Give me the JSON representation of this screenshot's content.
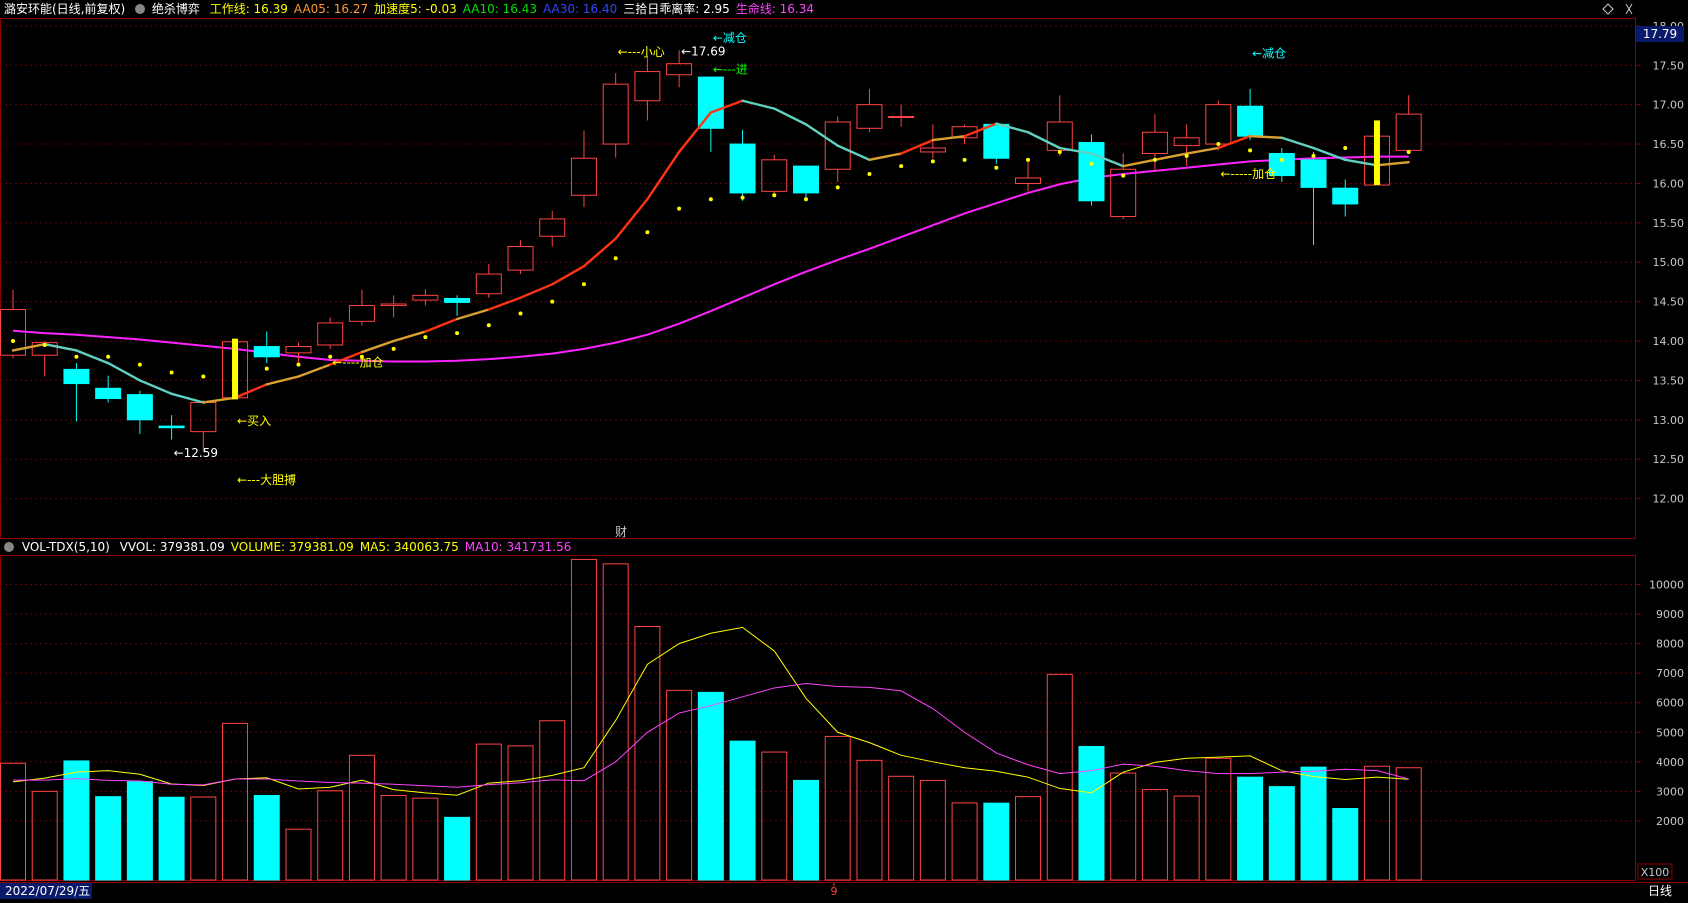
{
  "header": {
    "title": "潞安环能(日线,前复权)",
    "indicator": "绝杀博弈",
    "items": [
      {
        "label": "工作线:",
        "value": "16.39",
        "color": "#ffff00"
      },
      {
        "label": "AA05:",
        "value": "16.27",
        "color": "#ff9933"
      },
      {
        "label": "加速度5:",
        "value": "-0.03",
        "color": "#ffff00"
      },
      {
        "label": "AA10:",
        "value": "16.43",
        "color": "#00e000"
      },
      {
        "label": "AA30:",
        "value": "16.40",
        "color": "#3344ff"
      },
      {
        "label": "三拾日乖离率:",
        "value": "2.95",
        "color": "#ffffff"
      },
      {
        "label": "生命线:",
        "value": "16.34",
        "color": "#ff44ff"
      }
    ]
  },
  "vol_header": {
    "title": "VOL-TDX(5,10)",
    "items": [
      {
        "label": "VVOL:",
        "value": "379381.09",
        "color": "#ffffff"
      },
      {
        "label": "VOLUME:",
        "value": "379381.09",
        "color": "#ffff00"
      },
      {
        "label": "MA5:",
        "value": "340063.75",
        "color": "#ffff00"
      },
      {
        "label": "MA10:",
        "value": "341731.56",
        "color": "#ff44ff"
      }
    ]
  },
  "price_badge": "17.79",
  "footer": {
    "date": "2022/07/29/五",
    "month_marker": "9",
    "period": "日线"
  },
  "vol_unit": "X100",
  "finance_marker": "财",
  "colors": {
    "up": "#ff4444",
    "down": "#00ffff",
    "life": "#ff22ff",
    "dots": "#ffff00",
    "grid": "#660000",
    "text": "#c8c8c8"
  },
  "chart_data": {
    "type": "candlestick",
    "price_axis": {
      "ticks": [
        12.0,
        12.5,
        13.0,
        13.5,
        14.0,
        14.5,
        15.0,
        15.5,
        16.0,
        16.5,
        17.0,
        17.5,
        18.0
      ],
      "tick_labels": [
        "12.00",
        "12.50",
        "13.00",
        "13.50",
        "14.00",
        "14.50",
        "15.00",
        "15.50",
        "16.00",
        "16.50",
        "17.00",
        "17.50",
        "18.00"
      ],
      "range": [
        11.5,
        18.1
      ]
    },
    "volume_axis": {
      "ticks": [
        2000,
        3000,
        4000,
        5000,
        6000,
        7000,
        8000,
        9000,
        10000
      ],
      "tick_labels": [
        "2000",
        "3000",
        "4000",
        "5000",
        "6000",
        "7000",
        "8000",
        "9000",
        "10000"
      ],
      "range": [
        0,
        11000
      ]
    },
    "candles": [
      {
        "o": 13.82,
        "h": 14.65,
        "l": 13.78,
        "c": 14.4,
        "v": 3950
      },
      {
        "o": 13.82,
        "h": 14.0,
        "l": 13.55,
        "c": 13.98,
        "v": 3000
      },
      {
        "o": 13.64,
        "h": 13.72,
        "l": 12.98,
        "c": 13.46,
        "v": 4030
      },
      {
        "o": 13.4,
        "h": 13.56,
        "l": 13.22,
        "c": 13.27,
        "v": 2820
      },
      {
        "o": 13.32,
        "h": 13.37,
        "l": 12.82,
        "c": 13.0,
        "v": 3330
      },
      {
        "o": 12.92,
        "h": 13.06,
        "l": 12.75,
        "c": 12.9,
        "v": 2800
      },
      {
        "o": 12.85,
        "h": 13.25,
        "l": 12.59,
        "c": 13.22,
        "v": 2810
      },
      {
        "o": 13.28,
        "h": 14.03,
        "l": 13.26,
        "c": 13.99,
        "v": 5300
      },
      {
        "o": 13.93,
        "h": 14.12,
        "l": 13.72,
        "c": 13.8,
        "v": 2860
      },
      {
        "o": 13.85,
        "h": 13.98,
        "l": 13.72,
        "c": 13.93,
        "v": 1720
      },
      {
        "o": 13.95,
        "h": 14.3,
        "l": 13.9,
        "c": 14.23,
        "v": 3020
      },
      {
        "o": 14.25,
        "h": 14.65,
        "l": 14.2,
        "c": 14.45,
        "v": 4220
      },
      {
        "o": 14.45,
        "h": 14.58,
        "l": 14.3,
        "c": 14.47,
        "v": 2860
      },
      {
        "o": 14.52,
        "h": 14.66,
        "l": 14.45,
        "c": 14.58,
        "v": 2770
      },
      {
        "o": 14.54,
        "h": 14.58,
        "l": 14.32,
        "c": 14.49,
        "v": 2120
      },
      {
        "o": 14.6,
        "h": 14.98,
        "l": 14.55,
        "c": 14.85,
        "v": 4600
      },
      {
        "o": 14.9,
        "h": 15.28,
        "l": 14.85,
        "c": 15.2,
        "v": 4540
      },
      {
        "o": 15.33,
        "h": 15.65,
        "l": 15.2,
        "c": 15.55,
        "v": 5390
      },
      {
        "o": 15.85,
        "h": 16.67,
        "l": 15.7,
        "c": 16.32,
        "v": 10850
      },
      {
        "o": 16.5,
        "h": 17.4,
        "l": 16.33,
        "c": 17.26,
        "v": 10700
      },
      {
        "o": 17.05,
        "h": 17.62,
        "l": 16.8,
        "c": 17.42,
        "v": 8580
      },
      {
        "o": 17.38,
        "h": 17.69,
        "l": 17.22,
        "c": 17.52,
        "v": 6420
      },
      {
        "o": 17.35,
        "h": 17.35,
        "l": 16.4,
        "c": 16.7,
        "v": 6350
      },
      {
        "o": 16.5,
        "h": 16.68,
        "l": 15.78,
        "c": 15.88,
        "v": 4700
      },
      {
        "o": 15.9,
        "h": 16.36,
        "l": 15.84,
        "c": 16.3,
        "v": 4330
      },
      {
        "o": 16.22,
        "h": 16.22,
        "l": 15.8,
        "c": 15.88,
        "v": 3370
      },
      {
        "o": 16.18,
        "h": 16.85,
        "l": 16.02,
        "c": 16.78,
        "v": 4860
      },
      {
        "o": 16.7,
        "h": 17.2,
        "l": 16.65,
        "c": 17.0,
        "v": 4050
      },
      {
        "o": 16.85,
        "h": 17.0,
        "l": 16.72,
        "c": 16.85,
        "v": 3510
      },
      {
        "o": 16.4,
        "h": 16.75,
        "l": 16.32,
        "c": 16.45,
        "v": 3370
      },
      {
        "o": 16.58,
        "h": 16.75,
        "l": 16.5,
        "c": 16.72,
        "v": 2610
      },
      {
        "o": 16.75,
        "h": 16.76,
        "l": 16.25,
        "c": 16.32,
        "v": 2600
      },
      {
        "o": 16.0,
        "h": 16.28,
        "l": 15.9,
        "c": 16.07,
        "v": 2820
      },
      {
        "o": 16.42,
        "h": 17.12,
        "l": 16.35,
        "c": 16.78,
        "v": 6960
      },
      {
        "o": 16.52,
        "h": 16.62,
        "l": 15.72,
        "c": 15.78,
        "v": 4520
      },
      {
        "o": 15.58,
        "h": 16.38,
        "l": 15.55,
        "c": 16.18,
        "v": 3620
      },
      {
        "o": 16.38,
        "h": 16.88,
        "l": 16.15,
        "c": 16.65,
        "v": 3060
      },
      {
        "o": 16.48,
        "h": 16.75,
        "l": 16.22,
        "c": 16.58,
        "v": 2840
      },
      {
        "o": 16.5,
        "h": 17.05,
        "l": 16.42,
        "c": 17.0,
        "v": 4120
      },
      {
        "o": 16.98,
        "h": 17.2,
        "l": 16.55,
        "c": 16.6,
        "v": 3480
      },
      {
        "o": 16.38,
        "h": 16.45,
        "l": 16.02,
        "c": 16.1,
        "v": 3160
      },
      {
        "o": 16.3,
        "h": 16.4,
        "l": 15.22,
        "c": 15.95,
        "v": 3820
      },
      {
        "o": 15.94,
        "h": 16.05,
        "l": 15.58,
        "c": 15.74,
        "v": 2420
      },
      {
        "o": 15.98,
        "h": 16.8,
        "l": 15.98,
        "c": 16.6,
        "v": 3850
      },
      {
        "o": 16.42,
        "h": 17.12,
        "l": 16.4,
        "c": 16.88,
        "v": 3800
      }
    ],
    "work_line": [
      13.88,
      13.96,
      13.88,
      13.72,
      13.5,
      13.33,
      13.22,
      13.28,
      13.45,
      13.55,
      13.7,
      13.86,
      14.0,
      14.12,
      14.28,
      14.4,
      14.55,
      14.72,
      14.95,
      15.3,
      15.8,
      16.4,
      16.9,
      17.05,
      16.95,
      16.75,
      16.48,
      16.3,
      16.38,
      16.55,
      16.6,
      16.76,
      16.65,
      16.45,
      16.38,
      16.22,
      16.3,
      16.38,
      16.45,
      16.6,
      16.58,
      16.45,
      16.3,
      16.23,
      16.27
    ],
    "life_line": [
      14.13,
      14.1,
      14.08,
      14.05,
      14.02,
      13.98,
      13.94,
      13.9,
      13.85,
      13.8,
      13.76,
      13.75,
      13.74,
      13.74,
      13.75,
      13.77,
      13.8,
      13.84,
      13.9,
      13.98,
      14.08,
      14.22,
      14.38,
      14.55,
      14.72,
      14.88,
      15.03,
      15.17,
      15.32,
      15.47,
      15.62,
      15.75,
      15.88,
      15.99,
      16.07,
      16.12,
      16.16,
      16.2,
      16.24,
      16.28,
      16.3,
      16.32,
      16.33,
      16.34,
      16.34
    ],
    "dots": [
      14.0,
      13.95,
      13.8,
      13.8,
      13.7,
      13.6,
      13.55,
      13.5,
      13.65,
      13.7,
      13.8,
      13.8,
      13.9,
      14.05,
      14.1,
      14.2,
      14.35,
      14.5,
      14.72,
      15.05,
      15.38,
      15.68,
      15.8,
      15.82,
      15.85,
      15.8,
      15.95,
      16.12,
      16.22,
      16.28,
      16.3,
      16.2,
      16.3,
      16.4,
      16.25,
      16.1,
      16.3,
      16.35,
      16.5,
      16.42,
      16.3,
      16.35,
      16.45,
      16.3,
      16.4
    ],
    "vol_ma5": [
      3320,
      3450,
      3650,
      3700,
      3580,
      3250,
      3200,
      3420,
      3460,
      3080,
      3140,
      3380,
      3060,
      2950,
      2870,
      3280,
      3360,
      3540,
      3800,
      5400,
      7300,
      8000,
      8350,
      8550,
      7750,
      6150,
      5000,
      4650,
      4220,
      4000,
      3800,
      3680,
      3480,
      3100,
      2950,
      3650,
      3980,
      4120,
      4160,
      4200,
      3700,
      3500,
      3400,
      3480,
      3410
    ],
    "vol_ma10": [
      3380,
      3380,
      3430,
      3370,
      3350,
      3240,
      3220,
      3420,
      3420,
      3350,
      3300,
      3280,
      3240,
      3190,
      3140,
      3230,
      3290,
      3390,
      3360,
      4000,
      5000,
      5650,
      5900,
      6200,
      6500,
      6650,
      6550,
      6520,
      6400,
      5800,
      5000,
      4300,
      3900,
      3600,
      3700,
      3920,
      3850,
      3700,
      3600,
      3600,
      3650,
      3680,
      3750,
      3700,
      3420
    ],
    "annotations": [
      {
        "text": "←12.59",
        "bar": 5,
        "price": 12.59,
        "color": "#ffffff"
      },
      {
        "text": "←买入",
        "bar": 7,
        "price": 13.0,
        "color": "#ffff00"
      },
      {
        "text": "←---大胆搏",
        "bar": 7,
        "price": 12.25,
        "color": "#ffff00"
      },
      {
        "text": "←----加仓",
        "bar": 10,
        "price": 13.74,
        "color": "#ffff00"
      },
      {
        "text": "←---小心",
        "bar": 19,
        "price": 17.68,
        "color": "#ffff00"
      },
      {
        "text": "←17.69",
        "bar": 21,
        "price": 17.69,
        "color": "#ffffff"
      },
      {
        "text": "←减仓",
        "bar": 22,
        "price": 17.86,
        "color": "#00ffff"
      },
      {
        "text": "←---进",
        "bar": 22,
        "price": 17.46,
        "color": "#00ff00"
      },
      {
        "text": "←减仓",
        "bar": 39,
        "price": 17.66,
        "color": "#00ffff"
      },
      {
        "text": "←-----加仓",
        "bar": 38,
        "price": 16.13,
        "color": "#ffff00"
      }
    ],
    "signal_bars": [
      {
        "bar": 7,
        "from": 13.26,
        "to": 14.03
      },
      {
        "bar": 43,
        "from": 15.98,
        "to": 16.8
      }
    ]
  }
}
